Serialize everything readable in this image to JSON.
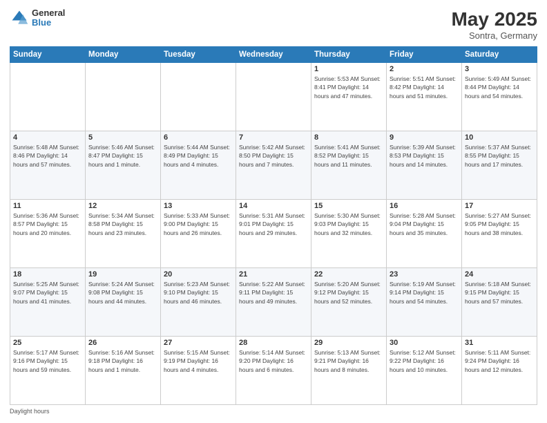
{
  "header": {
    "logo_general": "General",
    "logo_blue": "Blue",
    "title": "May 2025",
    "location": "Sontra, Germany"
  },
  "days_of_week": [
    "Sunday",
    "Monday",
    "Tuesday",
    "Wednesday",
    "Thursday",
    "Friday",
    "Saturday"
  ],
  "footer": "Daylight hours",
  "weeks": [
    [
      {
        "day": "",
        "info": ""
      },
      {
        "day": "",
        "info": ""
      },
      {
        "day": "",
        "info": ""
      },
      {
        "day": "",
        "info": ""
      },
      {
        "day": "1",
        "info": "Sunrise: 5:53 AM\nSunset: 8:41 PM\nDaylight: 14 hours\nand 47 minutes."
      },
      {
        "day": "2",
        "info": "Sunrise: 5:51 AM\nSunset: 8:42 PM\nDaylight: 14 hours\nand 51 minutes."
      },
      {
        "day": "3",
        "info": "Sunrise: 5:49 AM\nSunset: 8:44 PM\nDaylight: 14 hours\nand 54 minutes."
      }
    ],
    [
      {
        "day": "4",
        "info": "Sunrise: 5:48 AM\nSunset: 8:46 PM\nDaylight: 14 hours\nand 57 minutes."
      },
      {
        "day": "5",
        "info": "Sunrise: 5:46 AM\nSunset: 8:47 PM\nDaylight: 15 hours\nand 1 minute."
      },
      {
        "day": "6",
        "info": "Sunrise: 5:44 AM\nSunset: 8:49 PM\nDaylight: 15 hours\nand 4 minutes."
      },
      {
        "day": "7",
        "info": "Sunrise: 5:42 AM\nSunset: 8:50 PM\nDaylight: 15 hours\nand 7 minutes."
      },
      {
        "day": "8",
        "info": "Sunrise: 5:41 AM\nSunset: 8:52 PM\nDaylight: 15 hours\nand 11 minutes."
      },
      {
        "day": "9",
        "info": "Sunrise: 5:39 AM\nSunset: 8:53 PM\nDaylight: 15 hours\nand 14 minutes."
      },
      {
        "day": "10",
        "info": "Sunrise: 5:37 AM\nSunset: 8:55 PM\nDaylight: 15 hours\nand 17 minutes."
      }
    ],
    [
      {
        "day": "11",
        "info": "Sunrise: 5:36 AM\nSunset: 8:57 PM\nDaylight: 15 hours\nand 20 minutes."
      },
      {
        "day": "12",
        "info": "Sunrise: 5:34 AM\nSunset: 8:58 PM\nDaylight: 15 hours\nand 23 minutes."
      },
      {
        "day": "13",
        "info": "Sunrise: 5:33 AM\nSunset: 9:00 PM\nDaylight: 15 hours\nand 26 minutes."
      },
      {
        "day": "14",
        "info": "Sunrise: 5:31 AM\nSunset: 9:01 PM\nDaylight: 15 hours\nand 29 minutes."
      },
      {
        "day": "15",
        "info": "Sunrise: 5:30 AM\nSunset: 9:03 PM\nDaylight: 15 hours\nand 32 minutes."
      },
      {
        "day": "16",
        "info": "Sunrise: 5:28 AM\nSunset: 9:04 PM\nDaylight: 15 hours\nand 35 minutes."
      },
      {
        "day": "17",
        "info": "Sunrise: 5:27 AM\nSunset: 9:05 PM\nDaylight: 15 hours\nand 38 minutes."
      }
    ],
    [
      {
        "day": "18",
        "info": "Sunrise: 5:25 AM\nSunset: 9:07 PM\nDaylight: 15 hours\nand 41 minutes."
      },
      {
        "day": "19",
        "info": "Sunrise: 5:24 AM\nSunset: 9:08 PM\nDaylight: 15 hours\nand 44 minutes."
      },
      {
        "day": "20",
        "info": "Sunrise: 5:23 AM\nSunset: 9:10 PM\nDaylight: 15 hours\nand 46 minutes."
      },
      {
        "day": "21",
        "info": "Sunrise: 5:22 AM\nSunset: 9:11 PM\nDaylight: 15 hours\nand 49 minutes."
      },
      {
        "day": "22",
        "info": "Sunrise: 5:20 AM\nSunset: 9:12 PM\nDaylight: 15 hours\nand 52 minutes."
      },
      {
        "day": "23",
        "info": "Sunrise: 5:19 AM\nSunset: 9:14 PM\nDaylight: 15 hours\nand 54 minutes."
      },
      {
        "day": "24",
        "info": "Sunrise: 5:18 AM\nSunset: 9:15 PM\nDaylight: 15 hours\nand 57 minutes."
      }
    ],
    [
      {
        "day": "25",
        "info": "Sunrise: 5:17 AM\nSunset: 9:16 PM\nDaylight: 15 hours\nand 59 minutes."
      },
      {
        "day": "26",
        "info": "Sunrise: 5:16 AM\nSunset: 9:18 PM\nDaylight: 16 hours\nand 1 minute."
      },
      {
        "day": "27",
        "info": "Sunrise: 5:15 AM\nSunset: 9:19 PM\nDaylight: 16 hours\nand 4 minutes."
      },
      {
        "day": "28",
        "info": "Sunrise: 5:14 AM\nSunset: 9:20 PM\nDaylight: 16 hours\nand 6 minutes."
      },
      {
        "day": "29",
        "info": "Sunrise: 5:13 AM\nSunset: 9:21 PM\nDaylight: 16 hours\nand 8 minutes."
      },
      {
        "day": "30",
        "info": "Sunrise: 5:12 AM\nSunset: 9:22 PM\nDaylight: 16 hours\nand 10 minutes."
      },
      {
        "day": "31",
        "info": "Sunrise: 5:11 AM\nSunset: 9:24 PM\nDaylight: 16 hours\nand 12 minutes."
      }
    ]
  ]
}
